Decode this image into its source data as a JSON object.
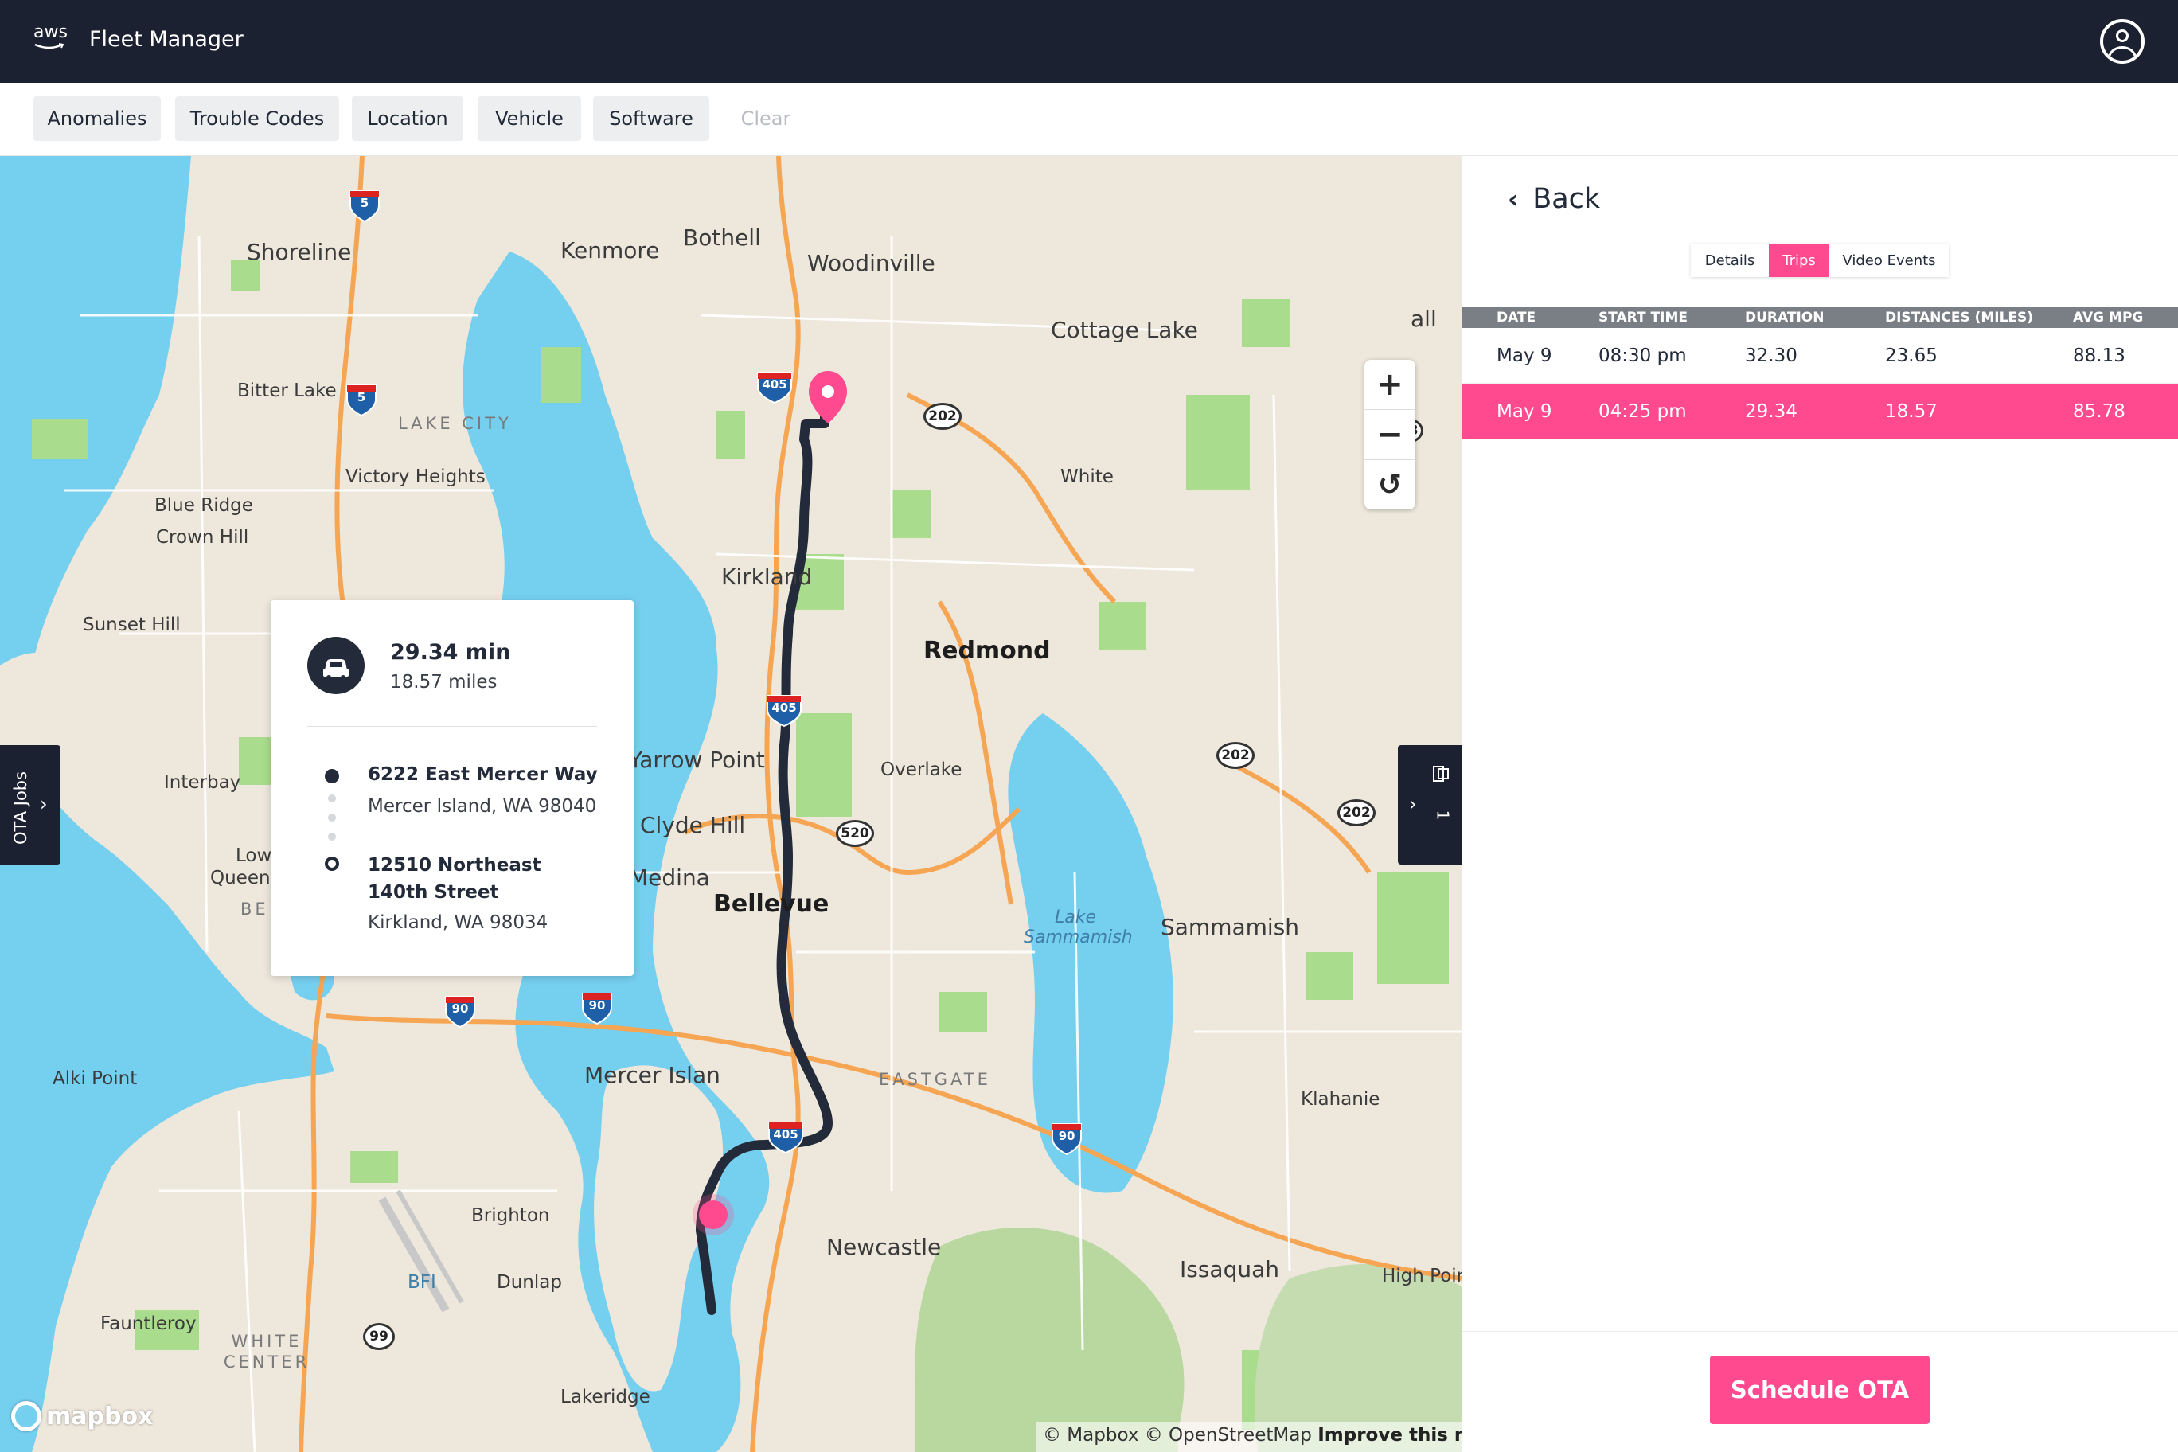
{
  "header": {
    "logo_text": "aws",
    "app_title": "Fleet Manager",
    "account_icon": "user-circle-icon"
  },
  "filters": {
    "chips": [
      "Anomalies",
      "Trouble Codes",
      "Location",
      "Vehicle",
      "Software"
    ],
    "clear_label": "Clear"
  },
  "map": {
    "places": {
      "shoreline": "Shoreline",
      "kenmore": "Kenmore",
      "bothell": "Bothell",
      "woodinville": "Woodinville",
      "cottage_lake": "Cottage Lake",
      "bitter_lake": "Bitter Lake",
      "lake_city": "LAKE CITY",
      "victory_heights": "Victory Heights",
      "blue_ridge": "Blue Ridge",
      "crown_hill": "Crown Hill",
      "white": "White",
      "kirkland": "Kirkland",
      "sunset_hill": "Sunset Hill",
      "redmond": "Redmond",
      "interbay": "Interbay",
      "yarrow_point": "Yarrow Point",
      "overlake": "Overlake",
      "clyde_hill": "Clyde Hill",
      "medina": "Medina",
      "lower_queen_1": "Low",
      "lower_queen_2": "Queen",
      "belltown": "BE",
      "bellevue": "Bellevue",
      "lake_sammamish": "Lake Sammamish",
      "sammamish": "Sammamish",
      "alki_point": "Alki Point",
      "mercer_island": "Mercer Islan",
      "eastgate": "EASTGATE",
      "klahanie": "Klahanie",
      "brighton": "Brighton",
      "newcastle": "Newcastle",
      "issaquah": "Issaquah",
      "high_point": "High Poir",
      "bfi": "BFI",
      "dunlap": "Dunlap",
      "fauntleroy": "Fauntleroy",
      "white_center": "WHITE CENTER",
      "lakeridge": "Lakeridge",
      "fall_city_fragment": "all"
    },
    "route_shields": {
      "i5_north": "5",
      "i5_south": "5",
      "i405_north": "405",
      "i405_mid": "405",
      "i405_south": "405",
      "i90_west": "90",
      "i90_mid": "90",
      "i90_east": "90"
    },
    "state_routes": {
      "sr202_a": "202",
      "sr202_b": "202",
      "sr202_c": "202",
      "sr203": "203",
      "sr520": "520",
      "sr99": "99"
    },
    "colors": {
      "water": "#75cfef",
      "land": "#ede7dc",
      "park": "#a9dc8c",
      "highway": "#f6a553",
      "route": "#232b3a",
      "interstate": "#1f5fa8",
      "accent": "#ff4a8f"
    },
    "zoom_in_label": "+",
    "zoom_out_label": "−",
    "reset_label": "↺",
    "attribution": "© Mapbox © OpenStreetMap",
    "improve_link": "Improve this map",
    "logo": "mapbox"
  },
  "trip_popup": {
    "duration": "29.34 min",
    "distance": "18.57 miles",
    "start_street": "6222 East Mercer Way",
    "start_city": "Mercer Island, WA 98040",
    "end_street": "12510 Northeast 140th Street",
    "end_city": "Kirkland, WA 98034",
    "icon": "car-icon"
  },
  "side_tabs": {
    "ota_jobs_label": "OTA Jobs",
    "right_count": "1",
    "right_icon": "vehicle-list-icon"
  },
  "panel": {
    "back_label": "Back",
    "tabs": [
      "Details",
      "Trips",
      "Video Events"
    ],
    "active_tab": "Trips",
    "columns": [
      "DATE",
      "START TIME",
      "DURATION",
      "DISTANCES (MILES)",
      "AVG MPG"
    ],
    "rows": [
      {
        "date": "May 9",
        "start": "08:30 pm",
        "duration": "32.30",
        "distance": "23.65",
        "mpg": "88.13",
        "selected": false
      },
      {
        "date": "May 9",
        "start": "04:25 pm",
        "duration": "29.34",
        "distance": "18.57",
        "mpg": "85.78",
        "selected": true
      }
    ],
    "schedule_button": "Schedule OTA"
  }
}
